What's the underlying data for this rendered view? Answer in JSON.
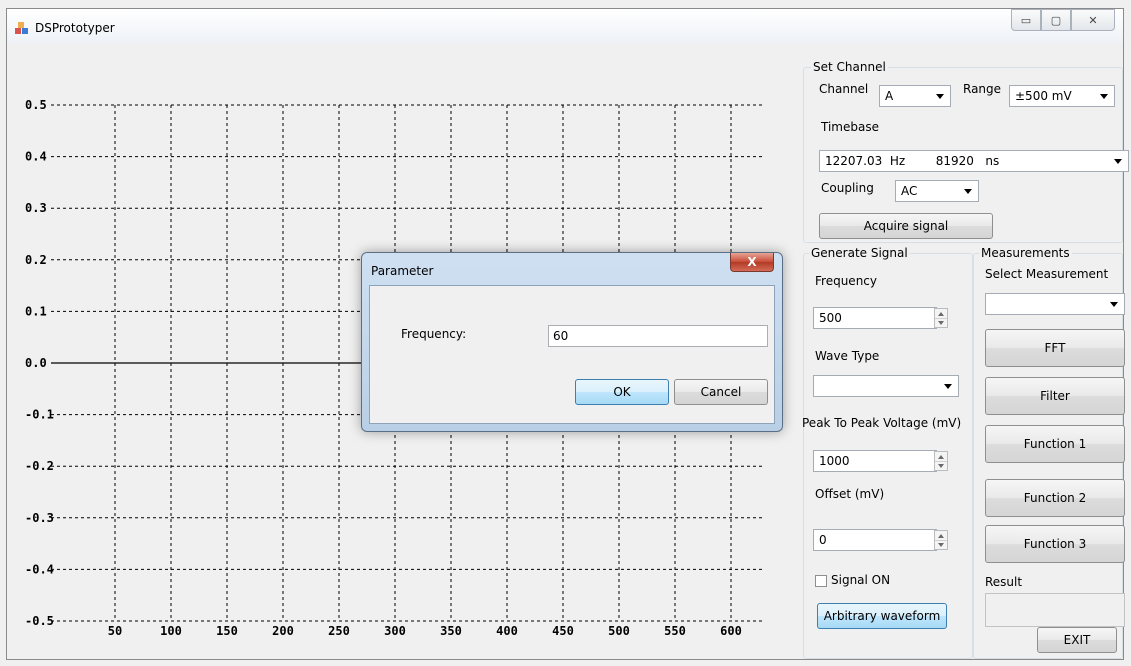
{
  "window": {
    "title": "DSPrototyper",
    "min_symbol": "▭",
    "max_symbol": "▢",
    "close_symbol": "✕"
  },
  "plot": {
    "y_ticks": [
      "0.5",
      "0.4",
      "0.3",
      "0.2",
      "0.1",
      "0.0",
      "-0.1",
      "-0.2",
      "-0.3",
      "-0.4",
      "-0.5"
    ],
    "x_ticks": [
      "50",
      "100",
      "150",
      "200",
      "250",
      "300",
      "350",
      "400",
      "450",
      "500",
      "550",
      "600"
    ],
    "signal_level": 0.0,
    "ylim": [
      -0.5,
      0.5
    ]
  },
  "set_channel": {
    "title": "Set Channel",
    "channel_label": "Channel",
    "channel_value": "A",
    "range_label": "Range",
    "range_value": "±500  mV",
    "timebase_label": "Timebase",
    "timebase_value": "12207.03  Hz        81920   ns",
    "coupling_label": "Coupling",
    "coupling_value": "AC",
    "acquire_button": "Acquire signal"
  },
  "generate_signal": {
    "title": "Generate Signal",
    "frequency_label": "Frequency",
    "frequency_value": "500",
    "wave_type_label": "Wave Type",
    "wave_type_value": "",
    "ptp_label": "Peak To Peak Voltage (mV)",
    "ptp_value": "1000",
    "offset_label": "Offset (mV)",
    "offset_value": "0",
    "signal_on_label": "Signal ON",
    "signal_on_checked": false,
    "arbitrary_button": "Arbitrary waveform"
  },
  "measurements": {
    "title": "Measurements",
    "select_label": "Select Measurement",
    "select_value": "",
    "fft_button": "FFT",
    "filter_button": "Filter",
    "function1_button": "Function 1",
    "function2_button": "Function 2",
    "function3_button": "Function 3",
    "result_label": "Result",
    "result_value": ""
  },
  "exit_button": "EXIT",
  "dialog": {
    "title": "Parameter",
    "close_symbol": "X",
    "field_label": "Frequency:",
    "field_value": "60",
    "ok_button": "OK",
    "cancel_button": "Cancel"
  }
}
